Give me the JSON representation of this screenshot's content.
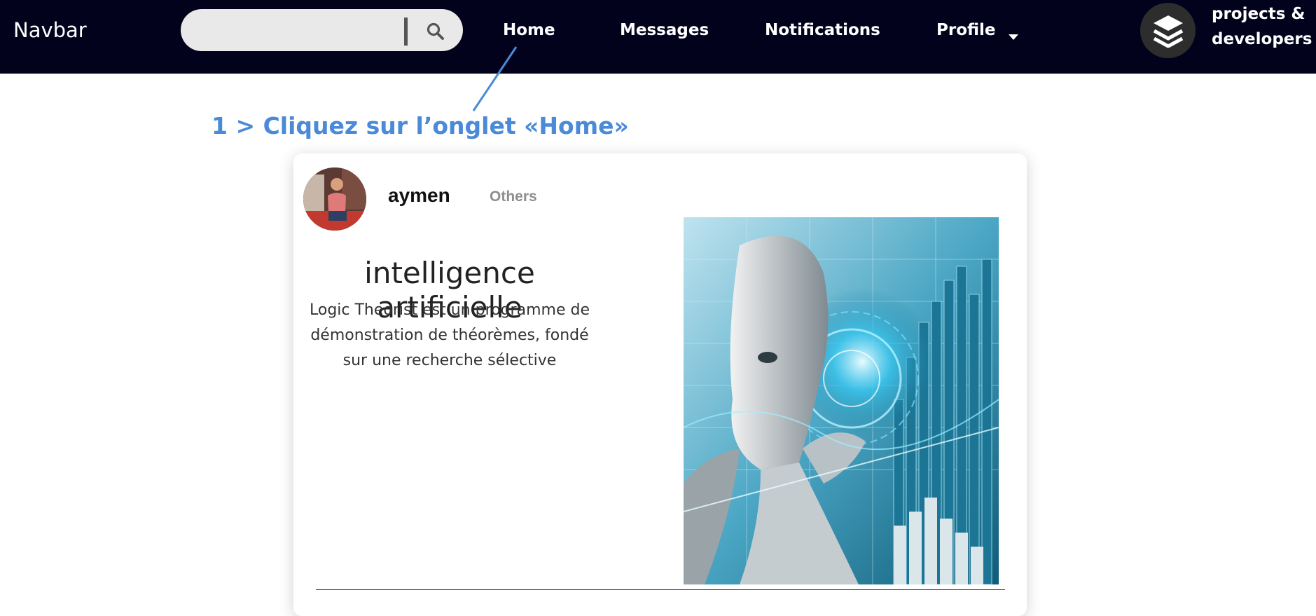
{
  "navbar": {
    "brand": "Navbar",
    "search": {
      "placeholder": "",
      "icon": "search-icon"
    },
    "links": [
      {
        "label": "Home"
      },
      {
        "label": "Messages"
      },
      {
        "label": "Notifications"
      },
      {
        "label": "Profile",
        "icon": "caret-down-icon"
      }
    ],
    "logo": {
      "icon": "layers-icon",
      "line1": "projects &",
      "line2": "developers"
    }
  },
  "annotation": {
    "text": "1 > Cliquez sur l’onglet «Home»",
    "color": "#4a8ad6"
  },
  "post": {
    "author": "aymen",
    "category": "Others",
    "title": "intelligence artificielle",
    "description": "Logic Theorist est un programme de démonstration de théorèmes, fondé sur une recherche sélective"
  },
  "colors": {
    "navbar_bg": "#02021c",
    "search_bg": "#e9e9e9",
    "accent": "#4a8ad6"
  }
}
